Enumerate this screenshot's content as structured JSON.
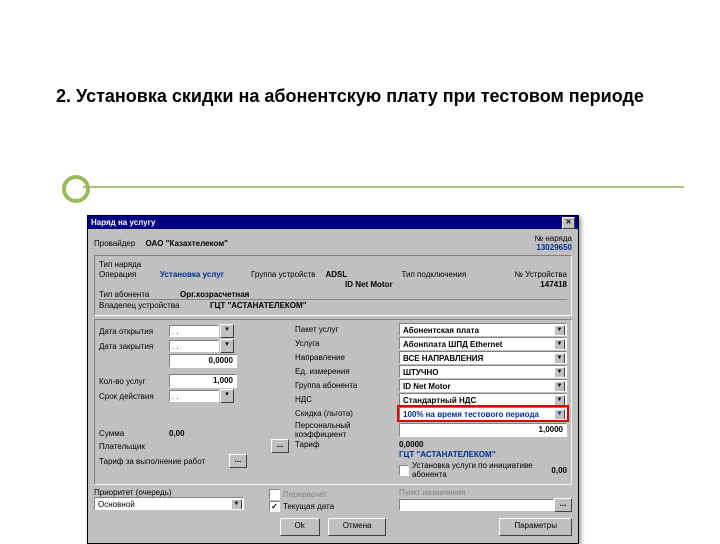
{
  "slide": {
    "title": "2. Установка скидки на абонентскую плату при тестовом периоде"
  },
  "dialog": {
    "title": "Наряд на услугу",
    "close_glyph": "✕",
    "top": {
      "provider_lbl": "Провайдер",
      "provider_val": "ОАО \"Казахтелеком\"",
      "order_no_lbl": "№ наряда",
      "order_no_val": "13029650"
    },
    "head": {
      "type_lbl": "Тип наряда",
      "op_lbl": "Операция",
      "op_val": "Установка услуг",
      "grp_lbl": "Группа устройств",
      "grp_val": "ADSL",
      "conn_lbl": "Тип подключения",
      "conn_val": "ID Net Motor",
      "devno_lbl": "№ Устройства",
      "devno_val": "147418",
      "abon_lbl": "Тип абонента",
      "org_val": "Орг.хозрасчетная",
      "owner_lbl": "Владелец устройства",
      "owner_val": "ГЦТ \"АСТАНАТЕЛЕКОМ\""
    },
    "left": {
      "date_open_lbl": "Дата открытия",
      "date_close_lbl": "Дата закрытия",
      "date_val": ". .",
      "zero": "0,0000",
      "qty_lbl": "Кол-во услуг",
      "qty_val": "1,000",
      "dur_lbl": "Срок действия",
      "dur_val": ". .",
      "sum_lbl": "Сумма",
      "sum_val": "0,00",
      "payer_lbl": "Плательщик",
      "work_lbl": "Тариф за выполнение работ"
    },
    "right": {
      "pkg_lbl": "Пакет услуг",
      "pkg_val": "Абонентская плата",
      "svc_lbl": "Услуга",
      "svc_val": "Абонплата ШПД Ethernet",
      "dir_lbl": "Направление",
      "dir_val": "ВСЕ НАПРАВЛЕНИЯ",
      "unit_lbl": "Ед. измерения",
      "unit_val": "ШТУЧНО",
      "agrp_lbl": "Группа абонента",
      "agrp_val": "ID Net Motor",
      "vat_lbl": "НДС",
      "vat_val": "Стандартный НДС",
      "disc_lbl": "Скидка (льгота)",
      "disc_val": "100% на время тестового периода",
      "coef_lbl": "Персональный коэффициент",
      "coef_val": "1,0000",
      "tarif_lbl": "Тариф",
      "tarif_val": "0,0000",
      "payer_val": "ГЦТ \"АСТАНАТЕЛЕКОМ\"",
      "init_lbl": "Установка услуги по инициативе абонента",
      "work_val": "0,00"
    },
    "bottom": {
      "prio_lbl": "Приоритет (очередь)",
      "prio_val": "Основной",
      "recalc_lbl": "Перерасчет",
      "curdate_lbl": "Текущая дата",
      "dest_lbl": "Пункт назначения",
      "ok": "Ok",
      "cancel": "Отмена",
      "params": "Параметры"
    }
  }
}
